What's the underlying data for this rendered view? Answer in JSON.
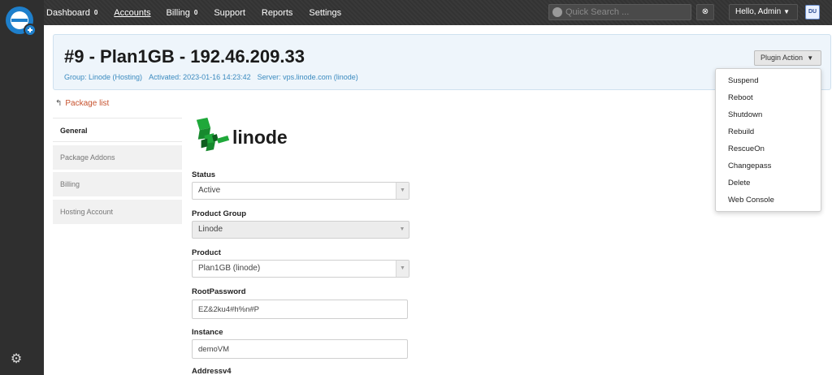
{
  "topbar": {
    "nav": [
      {
        "label": "Dashboard",
        "badge": "0"
      },
      {
        "label": "Accounts",
        "active": true
      },
      {
        "label": "Billing",
        "badge": "0"
      },
      {
        "label": "Support"
      },
      {
        "label": "Reports"
      },
      {
        "label": "Settings"
      }
    ],
    "search_placeholder": "Quick Search ...",
    "clear_icon": "x-circle-icon",
    "user_label": "Hello, Admin",
    "avatar_text": "DU"
  },
  "header": {
    "title": "#9 - Plan1GB - 192.46.209.33",
    "group": "Group: Linode (Hosting)",
    "activated": "Activated: 2023-01-16 14:23:42",
    "server": "Server: vps.linode.com (linode)",
    "plugin_button": "Plugin Action"
  },
  "plugin_menu": [
    "Suspend",
    "Reboot",
    "Shutdown",
    "Rebuild",
    "RescueOn",
    "Changepass",
    "Delete",
    "Web Console"
  ],
  "back_link": "Package list",
  "tabs": [
    "General",
    "Package Addons",
    "Billing",
    "Hosting Account"
  ],
  "brand": "linode",
  "form": {
    "status_label": "Status",
    "status_value": "Active",
    "product_group_label": "Product Group",
    "product_group_value": "Linode",
    "product_label": "Product",
    "product_value": "Plan1GB (linode)",
    "rootpassword_label": "RootPassword",
    "rootpassword_value": "EZ&2ku4#h%n#P",
    "instance_label": "Instance",
    "instance_value": "demoVM",
    "address_label": "Addressv4"
  },
  "colors": {
    "accent": "#3a8abf",
    "link": "#c7532f",
    "linode_green": "#1fa83a"
  }
}
